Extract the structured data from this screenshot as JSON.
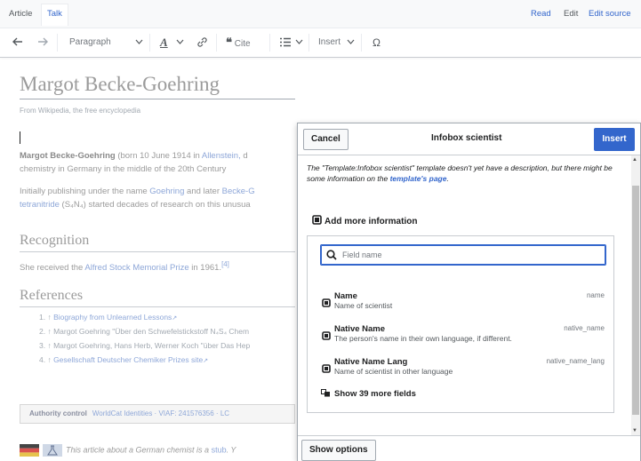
{
  "tabs": {
    "article": "Article",
    "talk": "Talk",
    "read": "Read",
    "edit": "Edit",
    "edit_source": "Edit source"
  },
  "toolbar": {
    "paragraph": "Paragraph",
    "cite": "Cite",
    "insert": "Insert",
    "special_char": "Ω",
    "text_style": "A"
  },
  "article": {
    "title": "Margot Becke-Goehring",
    "tagline": "From Wikipedia, the free encyclopedia",
    "p1_bold": "Margot Becke-Goehring",
    "p1_rest": " (born 10 June 1914 in ",
    "p1_link": "Allenstein,",
    "p1_tail": " d",
    "p1_line2": "chemistry in Germany in the middle of the 20th Century",
    "p2_line1_a": "Initially publishing under the name ",
    "p2_link1": "Goehring",
    "p2_line1_b": " and later ",
    "p2_link2": "Becke-G",
    "p2_link3": "tetranitride",
    "p2_line2": " (S₄N₄) started decades of research on this unusua",
    "h_recognition": "Recognition",
    "recognition_a": "She received the ",
    "recognition_link": "Alfred Stock Memorial Prize",
    "recognition_b": " in 1961.",
    "recognition_ref": "[4]",
    "h_references": "References",
    "refs": [
      {
        "num": "1. ↑ ",
        "text": "Biography from Unlearned Lessons",
        "link": true
      },
      {
        "num": "2. ↑ ",
        "text": "Margot Goehring \"Über den Schwefelstickstoff N₄S₄ Chem",
        "link": false
      },
      {
        "num": "3. ↑ ",
        "text": "Margot Goehring, Hans Herb, Werner Koch \"über Das Hep",
        "link": false
      },
      {
        "num": "4. ↑ ",
        "text": "Gesellschaft Deutscher Chemiker Prizes site",
        "link": true
      }
    ],
    "authority_label": "Authority control",
    "authority_links": "WorldCat Identities · VIAF: 241576356 · LC",
    "stub_text": "This article about a German chemist is a ",
    "stub_link": "stub",
    "stub_tail": ". Y"
  },
  "dialog": {
    "cancel": "Cancel",
    "title": "Infobox scientist",
    "insert": "Insert",
    "description_a": "The \"Template:Infobox scientist\" template doesn't yet have a description, but there might be some information on the ",
    "description_link": "template's page",
    "description_b": ".",
    "add_more": "Add more information",
    "search_placeholder": "Field name",
    "fields": [
      {
        "name": "Name",
        "desc": "Name of scientist",
        "key": "name"
      },
      {
        "name": "Native Name",
        "desc": "The person's name in their own language, if different.",
        "key": "native_name"
      },
      {
        "name": "Native Name Lang",
        "desc": "Name of scientist in other language",
        "key": "native_name_lang"
      }
    ],
    "more_fields": "Show 39 more fields",
    "show_options": "Show options"
  },
  "colors": {
    "accent": "#3366cc",
    "border": "#a2a9b1",
    "faded_text": "#9b9b9b"
  }
}
